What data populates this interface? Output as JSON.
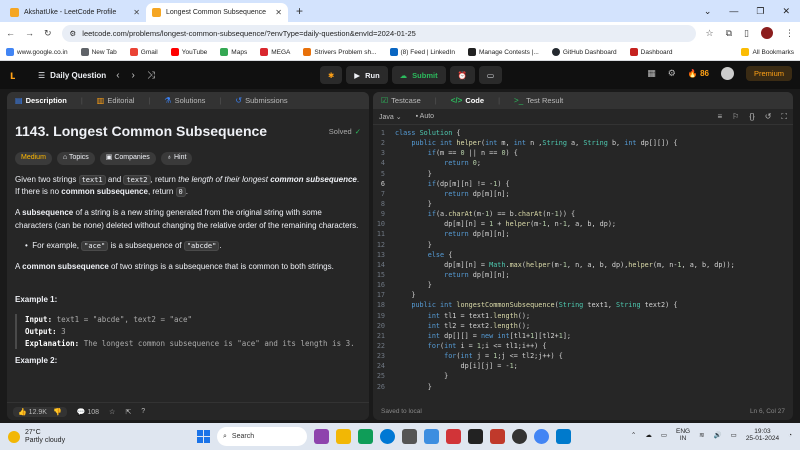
{
  "browser": {
    "tabs": [
      {
        "label": "AkshatUke - LeetCode Profile",
        "active": false
      },
      {
        "label": "Longest Common Subsequence",
        "active": true
      }
    ],
    "url": "leetcode.com/problems/longest-common-subsequence/?envType=daily-question&envId=2024-01-25",
    "bookmarks": [
      "www.google.co.in",
      "New Tab",
      "Gmail",
      "YouTube",
      "Maps",
      "MEGA",
      "Strivers Problem sh...",
      "(8) Feed | LinkedIn",
      "Manage Contests |...",
      "GitHub Dashboard",
      "Dashboard"
    ],
    "all_bookmarks": "All Bookmarks"
  },
  "nav": {
    "daily_question": "Daily Question",
    "run": "Run",
    "submit": "Submit",
    "streak": "86",
    "premium": "Premium"
  },
  "left": {
    "tabs": [
      "Description",
      "Editorial",
      "Solutions",
      "Submissions"
    ],
    "title": "1143. Longest Common Subsequence",
    "solved": "Solved",
    "chips": [
      "Medium",
      "Topics",
      "Companies",
      "Hint"
    ],
    "p1_a": "Given two strings ",
    "p1_code1": "text1",
    "p1_b": " and ",
    "p1_code2": "text2",
    "p1_c": ", return ",
    "p1_em": "the length of their longest",
    "p1_strong": "common subsequence",
    "p1_d": ". If there is no ",
    "p1_strong2": "common subsequence",
    "p1_e": ", return ",
    "p1_code3": "0",
    "p1_f": ".",
    "p2_strong": "subsequence",
    "p2_a": "A ",
    "p2_b": " of a string is a new string generated from the original string with some characters (can be none) deleted without changing the relative order of the remaining characters.",
    "bullet_a": "For example, ",
    "bullet_code1": "\"ace\"",
    "bullet_b": " is a subsequence of ",
    "bullet_code2": "\"abcde\"",
    "bullet_c": ".",
    "p3_a": "A ",
    "p3_strong": "common subsequence",
    "p3_b": " of two strings is a subsequence that is common to both strings.",
    "example1": "Example 1:",
    "ex_input_label": "Input:",
    "ex_input": " text1 = \"abcde\", text2 = \"ace\"",
    "ex_output_label": "Output:",
    "ex_output": " 3",
    "ex_expl_label": "Explanation:",
    "ex_expl": " The longest common subsequence is \"ace\" and its length is 3.",
    "example2": "Example 2:",
    "likes": "12.9K",
    "comments": "108"
  },
  "right": {
    "tabs": [
      "Testcase",
      "Code",
      "Test Result"
    ],
    "language": "Java",
    "auto": "Auto",
    "status": "Saved to local",
    "cursor": "Ln 6, Col 27",
    "current_line": 6,
    "code": [
      "class Solution {",
      "    public int helper(int m, int n ,String a, String b, int dp[][]) {",
      "        if(m == 0 || n == 0) {",
      "            return 0;",
      "        }",
      "        if(dp[m][n] != -1) {",
      "            return dp[m][n];",
      "        }",
      "        if(a.charAt(m-1) == b.charAt(n-1)) {",
      "            dp[m][n] = 1 + helper(m-1, n-1, a, b, dp);",
      "            return dp[m][n];",
      "        }",
      "        else {",
      "            dp[m][n] = Math.max(helper(m-1, n, a, b, dp),helper(m, n-1, a, b, dp));",
      "            return dp[m][n];",
      "        }",
      "    }",
      "    public int longestCommonSubsequence(String text1, String text2) {",
      "        int tl1 = text1.length();",
      "        int tl2 = text2.length();",
      "        int dp[][] = new int[tl1+1][tl2+1];",
      "        for(int i = 1;i <= tl1;i++) {",
      "            for(int j = 1;j <= tl2;j++) {",
      "                dp[i][j] = -1;",
      "            }",
      "        }"
    ]
  },
  "taskbar": {
    "temp": "27°C",
    "weather": "Partly cloudy",
    "search": "Search",
    "lang1": "ENG",
    "lang2": "IN",
    "time": "19:03",
    "date": "25-01-2024"
  }
}
